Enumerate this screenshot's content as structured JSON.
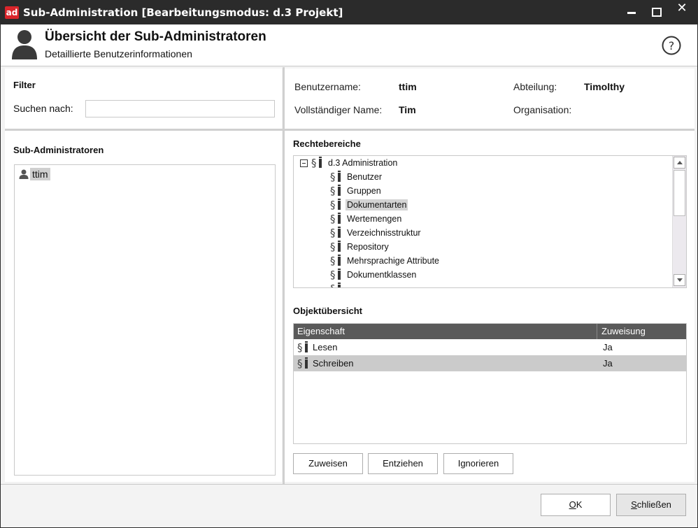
{
  "window": {
    "app_logo": "ad",
    "title": "Sub-Administration [Bearbeitungsmodus: d.3 Projekt]",
    "brand_color": "#d9252b"
  },
  "header": {
    "title": "Übersicht der Sub-Administratoren",
    "subtitle": "Detaillierte Benutzerinformationen",
    "icons": [
      "person-icon",
      "help-icon"
    ]
  },
  "filter": {
    "heading": "Filter",
    "search_label": "Suchen nach:",
    "search_value": "",
    "search_placeholder": ""
  },
  "user_info": {
    "username_label": "Benutzername:",
    "username_value": "ttim",
    "fullname_label": "Vollständiger Name:",
    "fullname_value": "Tim",
    "department_label": "Abteilung:",
    "department_value": "Timolthy",
    "organization_label": "Organisation:",
    "organization_value": ""
  },
  "subadmins": {
    "heading": "Sub-Administratoren",
    "items": [
      {
        "label": "ttim",
        "selected": true
      }
    ]
  },
  "rights": {
    "heading": "Rechtebereiche",
    "root": {
      "label": "d.3 Administration",
      "expanded": true
    },
    "children": [
      {
        "label": "Benutzer"
      },
      {
        "label": "Gruppen"
      },
      {
        "label": "Dokumentarten",
        "selected": true
      },
      {
        "label": "Wertemengen"
      },
      {
        "label": "Verzeichnisstruktur"
      },
      {
        "label": "Repository"
      },
      {
        "label": "Mehrsprachige Attribute"
      },
      {
        "label": "Dokumentklassen"
      }
    ]
  },
  "objects": {
    "heading": "Objektübersicht",
    "columns": [
      "Eigenschaft",
      "Zuweisung"
    ],
    "rows": [
      {
        "property": "Lesen",
        "assignment": "Ja",
        "selected": false
      },
      {
        "property": "Schreiben",
        "assignment": "Ja",
        "selected": true
      }
    ]
  },
  "actions": {
    "assign": "Zuweisen",
    "revoke": "Entziehen",
    "ignore": "Ignorieren"
  },
  "footer": {
    "ok_mnemonic": "O",
    "ok_rest": "K",
    "close_mnemonic": "S",
    "close_rest": "chließen"
  }
}
